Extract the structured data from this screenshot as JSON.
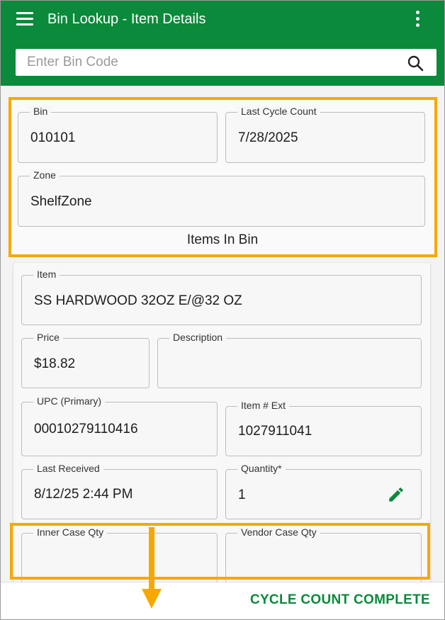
{
  "header": {
    "title": "Bin Lookup - Item Details",
    "accent_color": "#0a8a3a",
    "icons": [
      "hamburger-menu-icon",
      "more-vert-icon"
    ]
  },
  "search": {
    "placeholder": "Enter Bin Code",
    "value": ""
  },
  "bin": {
    "bin_label": "Bin",
    "bin_value": "010101",
    "last_cycle_count_label": "Last Cycle Count",
    "last_cycle_count_value": "7/28/2025",
    "zone_label": "Zone",
    "zone_value": "ShelfZone"
  },
  "items_heading": "Items In Bin",
  "item": {
    "item_label": "Item",
    "item_value": "SS HARDWOOD 32OZ E/@32 OZ",
    "price_label": "Price",
    "price_value": "$18.82",
    "description_label": "Description",
    "description_value": "",
    "upc_label": "UPC (Primary)",
    "upc_value": "00010279110416",
    "item_ext_label": "Item # Ext",
    "item_ext_value": "1027911041",
    "last_received_label": "Last Received",
    "last_received_value": "8/12/25 2:44 PM",
    "quantity_label": "Quantity*",
    "quantity_value": "1",
    "inner_case_label": "Inner Case Qty",
    "vendor_case_label": "Vendor Case Qty"
  },
  "footer": {
    "complete_label": "CYCLE COUNT COMPLETE"
  },
  "annotation_color": "#f5a800"
}
